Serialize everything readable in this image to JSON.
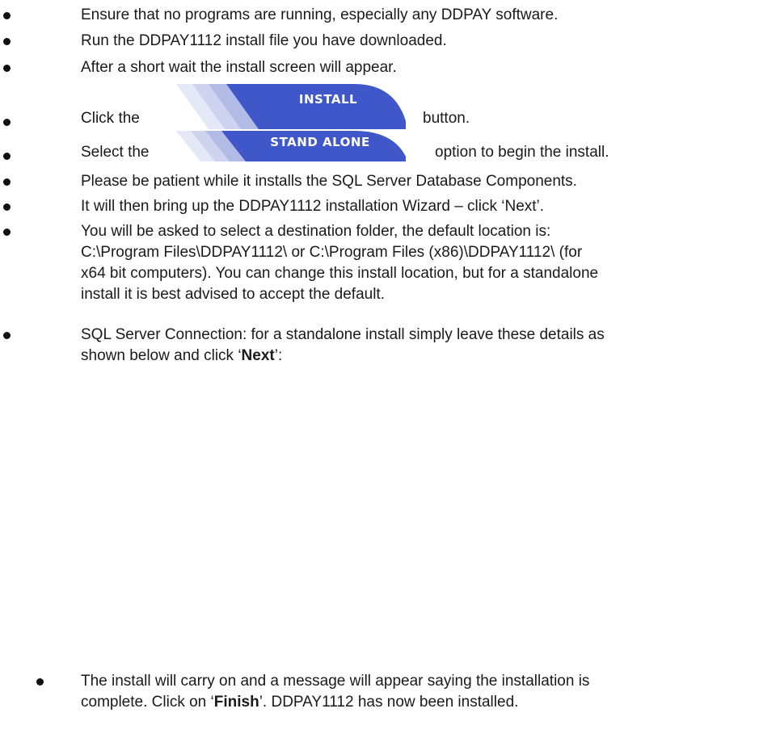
{
  "steps": [
    {
      "text": "Ensure that no programs are running, especially any DDPAY software."
    },
    {
      "text": "Run the DDPAY1112 install file you have downloaded."
    },
    {
      "text": "After a short wait the install screen will appear."
    },
    {
      "before": "Click the",
      "button": "INSTALL",
      "after": "button."
    },
    {
      "before": "Select the",
      "button": "STAND ALONE",
      "after": "option to begin the install."
    },
    {
      "text": "Please be patient while it installs the SQL Server Database Components."
    },
    {
      "text": "It will then bring up the DDPAY1112 installation Wizard – click ‘Next’."
    },
    {
      "lines": [
        "You will be asked to select a destination folder, the default location is:",
        "C:\\Program Files\\DDPAY1112\\ or C:\\Program Files (x86)\\DDPAY1112\\ (for",
        "x64 bit computers). You can change this install location, but for a standalone",
        "install it is best advised to accept the default."
      ]
    },
    {
      "line1": "SQL Server Connection: for a standalone install simply leave these details as",
      "line2_pre": "shown below and click ‘",
      "bold": "Next",
      "line2_post": "’:"
    },
    {
      "line1": "The install will carry on and a message will appear saying the installation is",
      "line2_pre": "complete. Click on ‘",
      "bold": "Finish",
      "line2_post": "’. DDPAY1112 has now been installed."
    }
  ],
  "colors": {
    "button_blue": "#3f57c9",
    "button_stripe": "#c6cdee"
  }
}
